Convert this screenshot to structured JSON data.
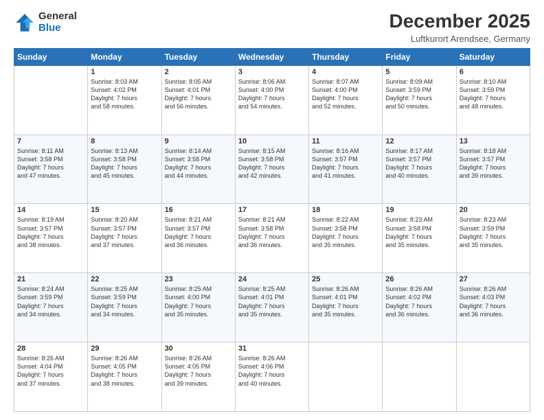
{
  "logo": {
    "general": "General",
    "blue": "Blue"
  },
  "title": "December 2025",
  "location": "Luftkurort Arendsee, Germany",
  "days_of_week": [
    "Sunday",
    "Monday",
    "Tuesday",
    "Wednesday",
    "Thursday",
    "Friday",
    "Saturday"
  ],
  "weeks": [
    [
      {
        "day": "",
        "info": ""
      },
      {
        "day": "1",
        "info": "Sunrise: 8:03 AM\nSunset: 4:02 PM\nDaylight: 7 hours\nand 58 minutes."
      },
      {
        "day": "2",
        "info": "Sunrise: 8:05 AM\nSunset: 4:01 PM\nDaylight: 7 hours\nand 56 minutes."
      },
      {
        "day": "3",
        "info": "Sunrise: 8:06 AM\nSunset: 4:00 PM\nDaylight: 7 hours\nand 54 minutes."
      },
      {
        "day": "4",
        "info": "Sunrise: 8:07 AM\nSunset: 4:00 PM\nDaylight: 7 hours\nand 52 minutes."
      },
      {
        "day": "5",
        "info": "Sunrise: 8:09 AM\nSunset: 3:59 PM\nDaylight: 7 hours\nand 50 minutes."
      },
      {
        "day": "6",
        "info": "Sunrise: 8:10 AM\nSunset: 3:59 PM\nDaylight: 7 hours\nand 48 minutes."
      }
    ],
    [
      {
        "day": "7",
        "info": "Sunrise: 8:11 AM\nSunset: 3:58 PM\nDaylight: 7 hours\nand 47 minutes."
      },
      {
        "day": "8",
        "info": "Sunrise: 8:13 AM\nSunset: 3:58 PM\nDaylight: 7 hours\nand 45 minutes."
      },
      {
        "day": "9",
        "info": "Sunrise: 8:14 AM\nSunset: 3:58 PM\nDaylight: 7 hours\nand 44 minutes."
      },
      {
        "day": "10",
        "info": "Sunrise: 8:15 AM\nSunset: 3:58 PM\nDaylight: 7 hours\nand 42 minutes."
      },
      {
        "day": "11",
        "info": "Sunrise: 8:16 AM\nSunset: 3:57 PM\nDaylight: 7 hours\nand 41 minutes."
      },
      {
        "day": "12",
        "info": "Sunrise: 8:17 AM\nSunset: 3:57 PM\nDaylight: 7 hours\nand 40 minutes."
      },
      {
        "day": "13",
        "info": "Sunrise: 8:18 AM\nSunset: 3:57 PM\nDaylight: 7 hours\nand 39 minutes."
      }
    ],
    [
      {
        "day": "14",
        "info": "Sunrise: 8:19 AM\nSunset: 3:57 PM\nDaylight: 7 hours\nand 38 minutes."
      },
      {
        "day": "15",
        "info": "Sunrise: 8:20 AM\nSunset: 3:57 PM\nDaylight: 7 hours\nand 37 minutes."
      },
      {
        "day": "16",
        "info": "Sunrise: 8:21 AM\nSunset: 3:57 PM\nDaylight: 7 hours\nand 36 minutes."
      },
      {
        "day": "17",
        "info": "Sunrise: 8:21 AM\nSunset: 3:58 PM\nDaylight: 7 hours\nand 36 minutes."
      },
      {
        "day": "18",
        "info": "Sunrise: 8:22 AM\nSunset: 3:58 PM\nDaylight: 7 hours\nand 35 minutes."
      },
      {
        "day": "19",
        "info": "Sunrise: 8:23 AM\nSunset: 3:58 PM\nDaylight: 7 hours\nand 35 minutes."
      },
      {
        "day": "20",
        "info": "Sunrise: 8:23 AM\nSunset: 3:59 PM\nDaylight: 7 hours\nand 35 minutes."
      }
    ],
    [
      {
        "day": "21",
        "info": "Sunrise: 8:24 AM\nSunset: 3:59 PM\nDaylight: 7 hours\nand 34 minutes."
      },
      {
        "day": "22",
        "info": "Sunrise: 8:25 AM\nSunset: 3:59 PM\nDaylight: 7 hours\nand 34 minutes."
      },
      {
        "day": "23",
        "info": "Sunrise: 8:25 AM\nSunset: 4:00 PM\nDaylight: 7 hours\nand 35 minutes."
      },
      {
        "day": "24",
        "info": "Sunrise: 8:25 AM\nSunset: 4:01 PM\nDaylight: 7 hours\nand 35 minutes."
      },
      {
        "day": "25",
        "info": "Sunrise: 8:26 AM\nSunset: 4:01 PM\nDaylight: 7 hours\nand 35 minutes."
      },
      {
        "day": "26",
        "info": "Sunrise: 8:26 AM\nSunset: 4:02 PM\nDaylight: 7 hours\nand 36 minutes."
      },
      {
        "day": "27",
        "info": "Sunrise: 8:26 AM\nSunset: 4:03 PM\nDaylight: 7 hours\nand 36 minutes."
      }
    ],
    [
      {
        "day": "28",
        "info": "Sunrise: 8:26 AM\nSunset: 4:04 PM\nDaylight: 7 hours\nand 37 minutes."
      },
      {
        "day": "29",
        "info": "Sunrise: 8:26 AM\nSunset: 4:05 PM\nDaylight: 7 hours\nand 38 minutes."
      },
      {
        "day": "30",
        "info": "Sunrise: 8:26 AM\nSunset: 4:05 PM\nDaylight: 7 hours\nand 39 minutes."
      },
      {
        "day": "31",
        "info": "Sunrise: 8:26 AM\nSunset: 4:06 PM\nDaylight: 7 hours\nand 40 minutes."
      },
      {
        "day": "",
        "info": ""
      },
      {
        "day": "",
        "info": ""
      },
      {
        "day": "",
        "info": ""
      }
    ]
  ]
}
